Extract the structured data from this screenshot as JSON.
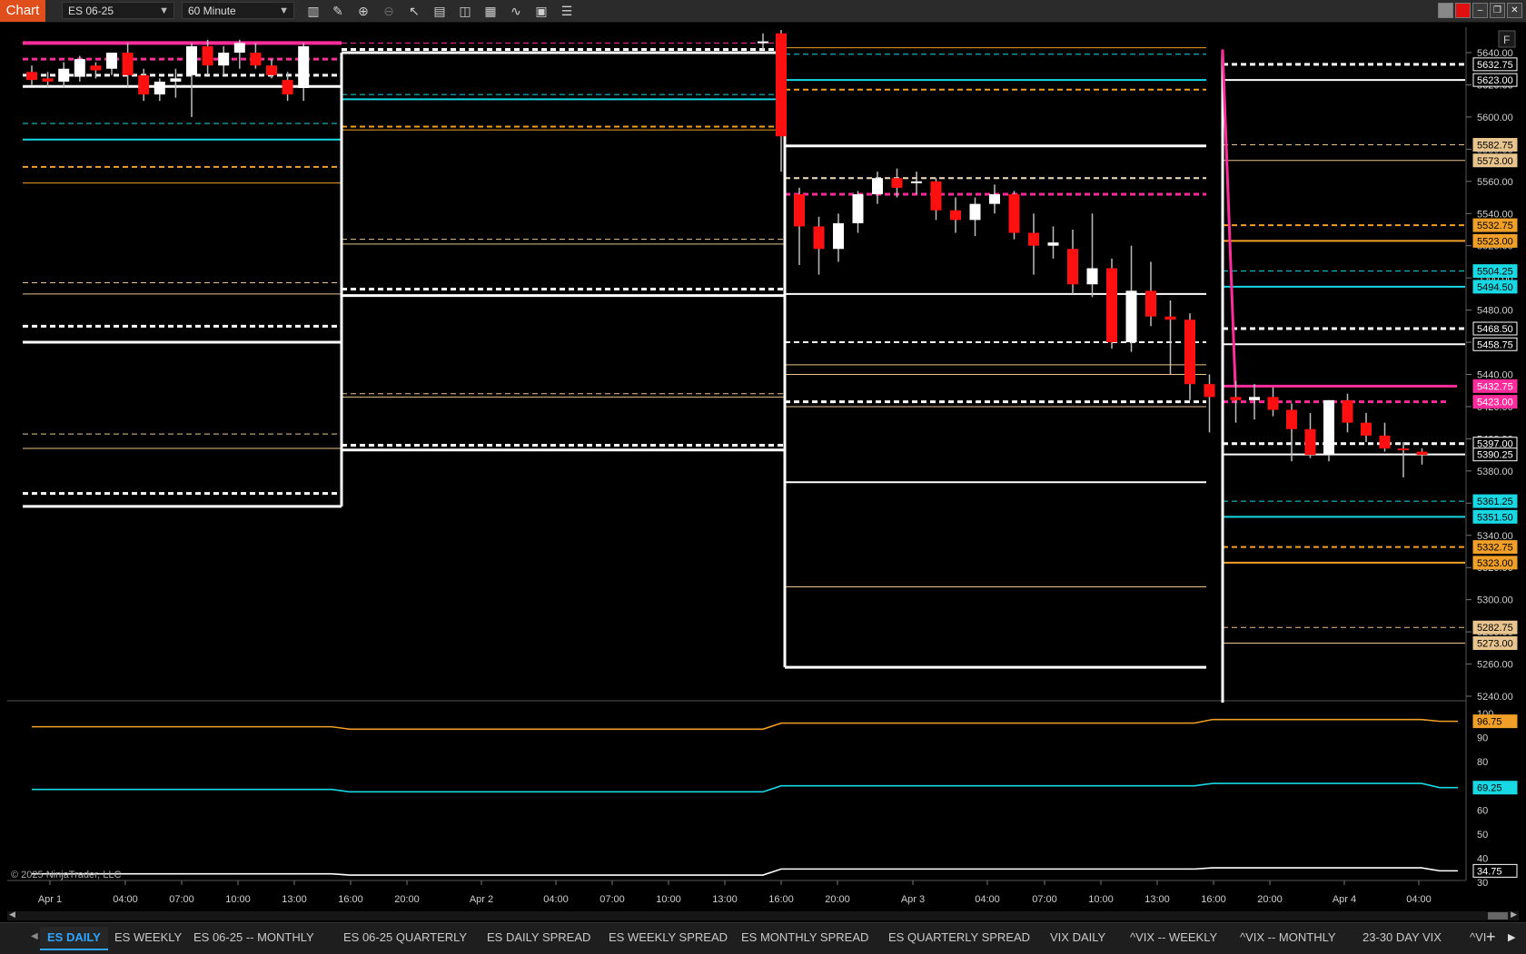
{
  "toolbar": {
    "chart_label": "Chart",
    "instrument": "ES 06-25",
    "interval": "60 Minute",
    "icons": [
      "bar-type-icon",
      "draw-icon",
      "zoom-in-icon",
      "zoom-out-icon",
      "pointer-icon",
      "template-icon",
      "properties-icon",
      "chart-trader-icon",
      "strategy-icon",
      "indicators-icon",
      "data-box-icon"
    ]
  },
  "copyright": "© 2025 NinjaTrader, LLC",
  "colors": {
    "white": "#ffffff",
    "cyan": "#18d8e4",
    "orange": "#f0a028",
    "tan": "#e8c48e",
    "magenta": "#ff2d9b",
    "up_candle": "#ffffff",
    "down_candle": "#ff1010"
  },
  "chart_data": {
    "type": "candlestick",
    "price_axis": {
      "ticks": [
        "5640.00",
        "5620.00",
        "5600.00",
        "5580.00",
        "5560.00",
        "5540.00",
        "5520.00",
        "5500.00",
        "5480.00",
        "5460.00",
        "5440.00",
        "5420.00",
        "5400.00",
        "5380.00",
        "5360.00",
        "5340.00",
        "5320.00",
        "5300.00",
        "5280.00",
        "5260.00",
        "5240.00"
      ],
      "range": [
        5236,
        5644
      ]
    },
    "time_axis": [
      "Apr 1",
      "04:00",
      "07:00",
      "10:00",
      "13:00",
      "16:00",
      "20:00",
      "Apr 2",
      "04:00",
      "07:00",
      "10:00",
      "13:00",
      "16:00",
      "20:00",
      "Apr 3",
      "04:00",
      "07:00",
      "10:00",
      "13:00",
      "16:00",
      "20:00",
      "Apr 4",
      "04:00"
    ],
    "price_labels": [
      {
        "text": "5632.75",
        "price": 5632.75,
        "style": "white"
      },
      {
        "text": "5623.00",
        "price": 5623.0,
        "style": "white"
      },
      {
        "text": "5582.75",
        "price": 5582.75,
        "style": "tan"
      },
      {
        "text": "5573.00",
        "price": 5573.0,
        "style": "tan"
      },
      {
        "text": "5532.75",
        "price": 5532.75,
        "style": "orange"
      },
      {
        "text": "5523.00",
        "price": 5523.0,
        "style": "orange"
      },
      {
        "text": "5504.25",
        "price": 5504.25,
        "style": "cyan"
      },
      {
        "text": "5494.50",
        "price": 5494.5,
        "style": "cyan"
      },
      {
        "text": "5468.50",
        "price": 5468.5,
        "style": "white"
      },
      {
        "text": "5458.75",
        "price": 5458.75,
        "style": "white"
      },
      {
        "text": "5432.75",
        "price": 5432.75,
        "style": "magenta"
      },
      {
        "text": "5423.00",
        "price": 5423.0,
        "style": "magenta"
      },
      {
        "text": "5397.00",
        "price": 5397.0,
        "style": "white"
      },
      {
        "text": "5390.25",
        "price": 5390.25,
        "style": "last"
      },
      {
        "text": "5361.25",
        "price": 5361.25,
        "style": "cyan"
      },
      {
        "text": "5351.50",
        "price": 5351.5,
        "style": "cyan"
      },
      {
        "text": "5332.75",
        "price": 5332.75,
        "style": "orange"
      },
      {
        "text": "5323.00",
        "price": 5323.0,
        "style": "orange"
      },
      {
        "text": "5282.75",
        "price": 5282.75,
        "style": "tan"
      },
      {
        "text": "5273.00",
        "price": 5273.0,
        "style": "tan"
      }
    ],
    "candles": [
      {
        "i": 0,
        "o": 5628,
        "h": 5632,
        "l": 5620,
        "c": 5623
      },
      {
        "i": 1,
        "o": 5624,
        "h": 5628,
        "l": 5618,
        "c": 5622
      },
      {
        "i": 2,
        "o": 5622,
        "h": 5634,
        "l": 5618,
        "c": 5630
      },
      {
        "i": 3,
        "o": 5625,
        "h": 5638,
        "l": 5622,
        "c": 5636
      },
      {
        "i": 4,
        "o": 5632,
        "h": 5634,
        "l": 5624,
        "c": 5629
      },
      {
        "i": 5,
        "o": 5630,
        "h": 5640,
        "l": 5626,
        "c": 5640
      },
      {
        "i": 6,
        "o": 5640,
        "h": 5646,
        "l": 5618,
        "c": 5626
      },
      {
        "i": 7,
        "o": 5626,
        "h": 5630,
        "l": 5610,
        "c": 5614
      },
      {
        "i": 8,
        "o": 5614,
        "h": 5624,
        "l": 5610,
        "c": 5622
      },
      {
        "i": 9,
        "o": 5622,
        "h": 5630,
        "l": 5612,
        "c": 5624
      },
      {
        "i": 10,
        "o": 5626,
        "h": 5646,
        "l": 5600,
        "c": 5644
      },
      {
        "i": 11,
        "o": 5644,
        "h": 5648,
        "l": 5626,
        "c": 5632
      },
      {
        "i": 12,
        "o": 5632,
        "h": 5644,
        "l": 5626,
        "c": 5640
      },
      {
        "i": 13,
        "o": 5640,
        "h": 5648,
        "l": 5630,
        "c": 5646
      },
      {
        "i": 14,
        "o": 5640,
        "h": 5646,
        "l": 5630,
        "c": 5632
      },
      {
        "i": 15,
        "o": 5632,
        "h": 5636,
        "l": 5624,
        "c": 5626
      },
      {
        "i": 16,
        "o": 5623,
        "h": 5628,
        "l": 5610,
        "c": 5614
      },
      {
        "i": 17,
        "o": 5618,
        "h": 5646,
        "l": 5610,
        "c": 5644
      },
      {
        "i": 18,
        "o": 5646,
        "h": 5652,
        "l": 5642,
        "c": 5647
      },
      {
        "i": 19,
        "o": 5652,
        "h": 5654,
        "l": 5566,
        "c": 5588
      },
      {
        "i": 20,
        "o": 5552,
        "h": 5556,
        "l": 5508,
        "c": 5532
      },
      {
        "i": 21,
        "o": 5532,
        "h": 5538,
        "l": 5502,
        "c": 5518
      },
      {
        "i": 22,
        "o": 5518,
        "h": 5540,
        "l": 5510,
        "c": 5534
      },
      {
        "i": 23,
        "o": 5534,
        "h": 5554,
        "l": 5528,
        "c": 5552
      },
      {
        "i": 24,
        "o": 5552,
        "h": 5566,
        "l": 5546,
        "c": 5562
      },
      {
        "i": 25,
        "o": 5562,
        "h": 5568,
        "l": 5550,
        "c": 5556
      },
      {
        "i": 26,
        "o": 5560,
        "h": 5566,
        "l": 5552,
        "c": 5560
      },
      {
        "i": 27,
        "o": 5560,
        "h": 5562,
        "l": 5536,
        "c": 5542
      },
      {
        "i": 28,
        "o": 5542,
        "h": 5550,
        "l": 5528,
        "c": 5536
      },
      {
        "i": 29,
        "o": 5536,
        "h": 5550,
        "l": 5526,
        "c": 5546
      },
      {
        "i": 30,
        "o": 5546,
        "h": 5558,
        "l": 5540,
        "c": 5552
      },
      {
        "i": 31,
        "o": 5552,
        "h": 5554,
        "l": 5524,
        "c": 5528
      },
      {
        "i": 32,
        "o": 5528,
        "h": 5540,
        "l": 5502,
        "c": 5520
      },
      {
        "i": 33,
        "o": 5520,
        "h": 5532,
        "l": 5512,
        "c": 5522
      },
      {
        "i": 34,
        "o": 5518,
        "h": 5530,
        "l": 5490,
        "c": 5496
      },
      {
        "i": 35,
        "o": 5496,
        "h": 5540,
        "l": 5488,
        "c": 5506
      },
      {
        "i": 36,
        "o": 5506,
        "h": 5512,
        "l": 5456,
        "c": 5460
      },
      {
        "i": 37,
        "o": 5460,
        "h": 5520,
        "l": 5454,
        "c": 5492
      },
      {
        "i": 38,
        "o": 5492,
        "h": 5510,
        "l": 5470,
        "c": 5476
      },
      {
        "i": 39,
        "o": 5476,
        "h": 5486,
        "l": 5440,
        "c": 5474
      },
      {
        "i": 40,
        "o": 5474,
        "h": 5478,
        "l": 5424,
        "c": 5434
      },
      {
        "i": 41,
        "o": 5434,
        "h": 5440,
        "l": 5404,
        "c": 5426
      },
      {
        "i": 42,
        "o": 5426,
        "h": 5436,
        "l": 5410,
        "c": 5424
      },
      {
        "i": 43,
        "o": 5424,
        "h": 5434,
        "l": 5412,
        "c": 5426
      },
      {
        "i": 44,
        "o": 5426,
        "h": 5432,
        "l": 5414,
        "c": 5418
      },
      {
        "i": 45,
        "o": 5418,
        "h": 5422,
        "l": 5386,
        "c": 5406
      },
      {
        "i": 46,
        "o": 5406,
        "h": 5416,
        "l": 5388,
        "c": 5390
      },
      {
        "i": 47,
        "o": 5390,
        "h": 5424,
        "l": 5386,
        "c": 5424
      },
      {
        "i": 48,
        "o": 5424,
        "h": 5428,
        "l": 5404,
        "c": 5410
      },
      {
        "i": 49,
        "o": 5410,
        "h": 5416,
        "l": 5398,
        "c": 5402
      },
      {
        "i": 50,
        "o": 5402,
        "h": 5410,
        "l": 5392,
        "c": 5394
      },
      {
        "i": 51,
        "o": 5394,
        "h": 5398,
        "l": 5376,
        "c": 5393
      },
      {
        "i": 52,
        "o": 5392,
        "h": 5394,
        "l": 5384,
        "c": 5390
      }
    ],
    "lower_panel": {
      "ticks": [
        "100",
        "90",
        "80",
        "70",
        "60",
        "50",
        "40",
        "30"
      ],
      "range": [
        28,
        102
      ],
      "labels": [
        {
          "text": "96.75",
          "value": 96.75,
          "style": "orange"
        },
        {
          "text": "69.25",
          "value": 69.25,
          "style": "cyan"
        },
        {
          "text": "34.75",
          "value": 34.75,
          "style": "white"
        }
      ]
    }
  },
  "tabs": [
    {
      "label": "ES DAILY",
      "active": true
    },
    {
      "label": "ES WEEKLY",
      "active": false
    },
    {
      "label": "ES 06-25 -- MONTHLY",
      "active": false
    },
    {
      "label": "ES 06-25 QUARTERLY",
      "active": false
    },
    {
      "label": "ES DAILY SPREAD",
      "active": false
    },
    {
      "label": "ES WEEKLY SPREAD",
      "active": false
    },
    {
      "label": "ES MONTHLY SPREAD",
      "active": false
    },
    {
      "label": "ES QUARTERLY SPREAD",
      "active": false
    },
    {
      "label": "VIX DAILY",
      "active": false
    },
    {
      "label": "^VIX -- WEEKLY",
      "active": false
    },
    {
      "label": "^VIX -- MONTHLY",
      "active": false
    },
    {
      "label": "23-30 DAY VIX",
      "active": false
    },
    {
      "label": "^VI",
      "active": false
    }
  ],
  "tab_controls": {
    "add": "+",
    "next": "▶",
    "prev": "◀"
  }
}
